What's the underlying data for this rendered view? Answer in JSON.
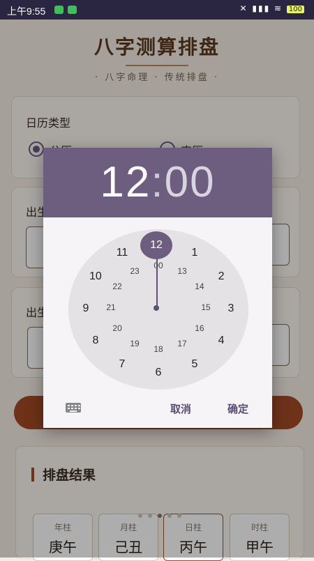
{
  "status_bar": {
    "time": "上午9:55",
    "battery": "100",
    "signal_icons": "✕ ▮▮▮ ≋"
  },
  "page": {
    "title": "八字测算排盘",
    "subtitle": "· 八字命理 · 传统排盘 ·",
    "calendar_card": {
      "label": "日历类型",
      "option_solar": "公历",
      "option_lunar": "农历",
      "selected": "公历"
    },
    "birth_card_1": {
      "label": "出生"
    },
    "birth_card_2": {
      "label": "出生"
    }
  },
  "result": {
    "title": "排盘结果",
    "pillars": [
      {
        "label": "年柱",
        "value": "庚午"
      },
      {
        "label": "月柱",
        "value": "己丑"
      },
      {
        "label": "日柱",
        "value": "丙午"
      },
      {
        "label": "时柱",
        "value": "甲午"
      }
    ],
    "pager_active_index": 2
  },
  "time_picker": {
    "hour": "12",
    "separator": ":",
    "minute": "00",
    "selected_hour": "12",
    "outer_hours": [
      "12",
      "1",
      "2",
      "3",
      "4",
      "5",
      "6",
      "7",
      "8",
      "9",
      "10",
      "11"
    ],
    "inner_hours": [
      "00",
      "13",
      "14",
      "15",
      "16",
      "17",
      "18",
      "19",
      "20",
      "21",
      "22",
      "23"
    ],
    "cancel_label": "取消",
    "ok_label": "确定"
  },
  "colors": {
    "header": "#6d5e80",
    "accent": "#a24b25",
    "status_bar": "#2a2540"
  }
}
